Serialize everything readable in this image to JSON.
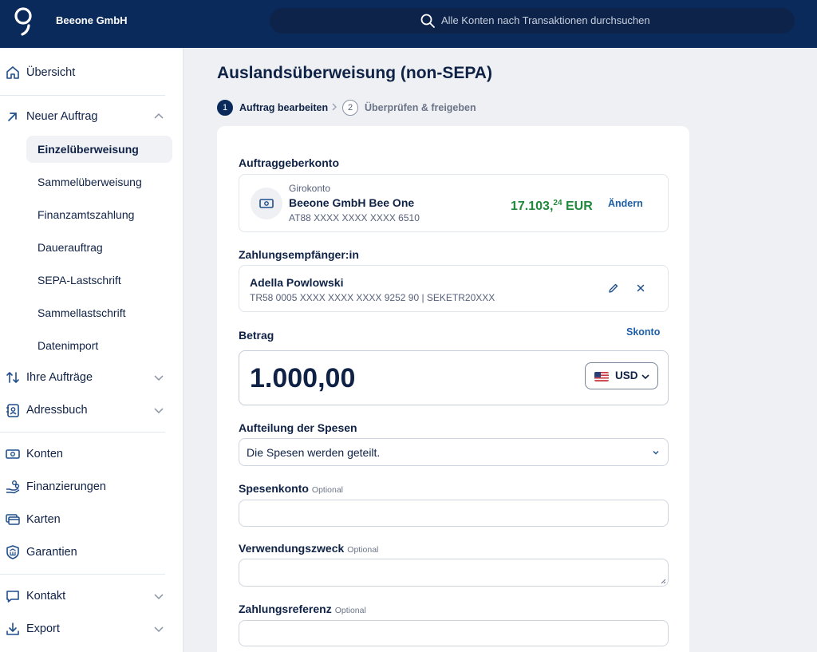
{
  "header": {
    "company": "Beeone GmbH",
    "search_placeholder": "Alle Konten nach Transaktionen durchsuchen"
  },
  "sidebar": {
    "overview": "Übersicht",
    "new_order": "Neuer Auftrag",
    "sub_items": [
      "Einzelüberweisung",
      "Sammelüberweisung",
      "Finanzamtszahlung",
      "Dauerauftrag",
      "SEPA-Lastschrift",
      "Sammellastschrift",
      "Datenimport"
    ],
    "active_sub": "Einzelüberweisung",
    "orders": "Ihre Aufträge",
    "address_book": "Adressbuch",
    "accounts": "Konten",
    "financing": "Finanzierungen",
    "cards": "Karten",
    "guarantees": "Garantien",
    "contact": "Kontakt",
    "export": "Export"
  },
  "page": {
    "title": "Auslandsüberweisung (non-SEPA)",
    "steps": [
      {
        "num": "1",
        "label": "Auftrag bearbeiten",
        "active": true
      },
      {
        "num": "2",
        "label": "Überprüfen & freigeben",
        "active": false
      }
    ]
  },
  "form": {
    "payer_label": "Auftraggeberkonto",
    "payer": {
      "type": "Girokonto",
      "name": "Beeone GmbH Bee One",
      "iban": "AT88 XXXX XXXX XXXX 6510",
      "balance_main": "17.103,",
      "balance_cents": "24",
      "balance_currency": " EUR",
      "change_label": "Ändern"
    },
    "recipient_label": "Zahlungsempfänger:in",
    "recipient": {
      "name": "Adella Powlowski",
      "details": "TR58 0005 XXXX XXXX XXXX 9252 90 | SEKETR20XXX"
    },
    "amount_label": "Betrag",
    "skonto_label": "Skonto",
    "amount_value": "1.000,00",
    "currency": "USD",
    "fees_label": "Aufteilung der Spesen",
    "fees_value": "Die Spesen werden geteilt.",
    "fee_account_label": "Spesenkonto",
    "purpose_label": "Verwendungszweck",
    "reference_label": "Zahlungsreferenz",
    "optional": "Optional"
  },
  "colors": {
    "header_bg": "#0b2a5c",
    "balance": "#1f8a3c",
    "link": "#1f5fa8"
  }
}
